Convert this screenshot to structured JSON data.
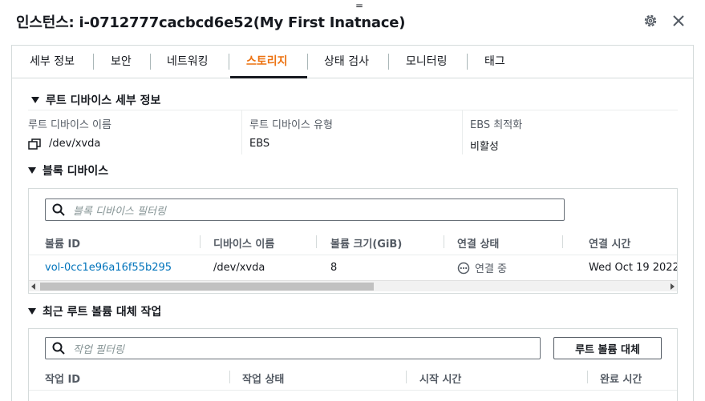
{
  "header": {
    "title": "인스턴스: i-0712777cacbcd6e52(My First Inatnace)",
    "title_mark": "=",
    "settings_icon": "settings-gear-icon",
    "close_icon": "close-icon"
  },
  "tabs": [
    {
      "label": "세부 정보",
      "active": false
    },
    {
      "label": "보안",
      "active": false
    },
    {
      "label": "네트워킹",
      "active": false
    },
    {
      "label": "스토리지",
      "active": true
    },
    {
      "label": "상태 검사",
      "active": false
    },
    {
      "label": "모니터링",
      "active": false
    },
    {
      "label": "태그",
      "active": false
    }
  ],
  "root_device": {
    "section_title": "루트 디바이스 세부 정보",
    "fields": [
      {
        "label": "루트 디바이스 이름",
        "value": "/dev/xvda"
      },
      {
        "label": "루트 디바이스 유형",
        "value": "EBS"
      },
      {
        "label": "EBS 최적화",
        "value": "비활성"
      }
    ]
  },
  "block_devices": {
    "section_title": "블록 디바이스",
    "filter_placeholder": "블록 디바이스 필터링",
    "columns": [
      "볼륨 ID",
      "디바이스 이름",
      "볼륨 크기(GiB)",
      "연결 상태",
      "연결 시간"
    ],
    "rows": [
      {
        "volume_id": "vol-0cc1e96a16f55b295",
        "device_name": "/dev/xvda",
        "size": "8",
        "status": "연결 중",
        "attach_time": "Wed Oct 19 2022"
      }
    ]
  },
  "root_replace": {
    "section_title": "최근 루트 볼륨 대체 작업",
    "filter_placeholder": "작업 필터링",
    "button_label": "루트 볼륨 대체",
    "columns": [
      "작업 ID",
      "작업 상태",
      "시작 시간",
      "완료 시간"
    ]
  },
  "colors": {
    "accent_tab": "#ec7211",
    "link": "#0073bb",
    "border": "#d5dbdb"
  }
}
